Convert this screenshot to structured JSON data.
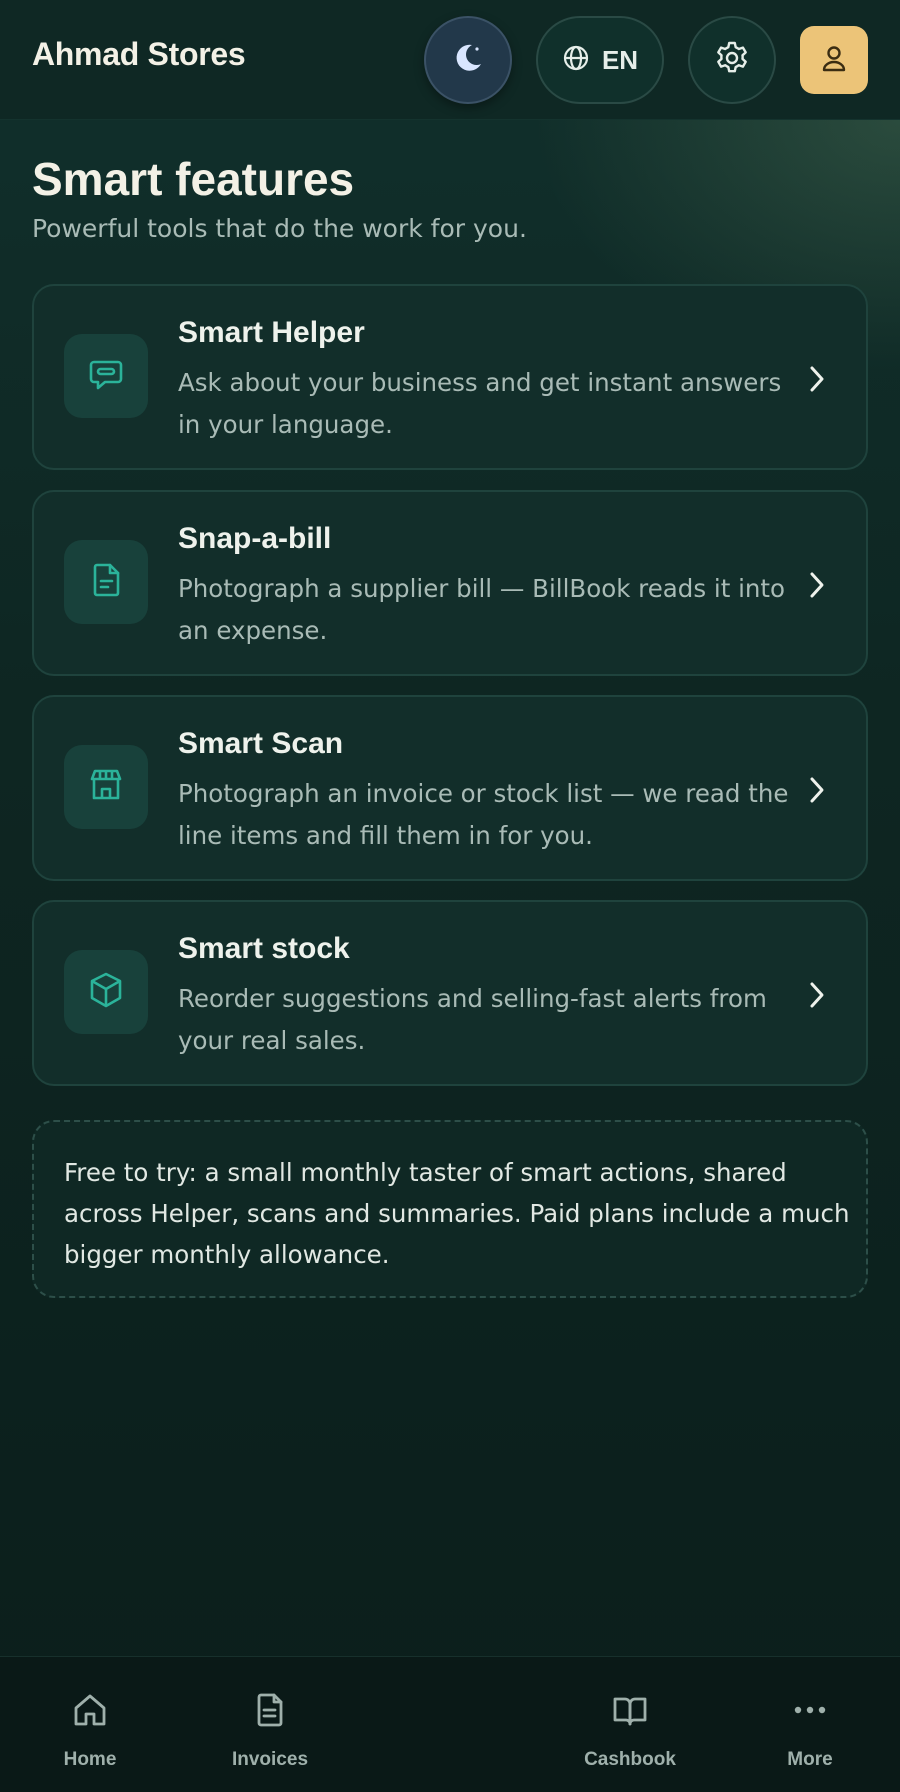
{
  "header": {
    "app_title": "Ahmad Stores",
    "language_label": "EN",
    "icons": {
      "theme": "moon-icon",
      "language": "globe-icon",
      "settings": "gear-icon",
      "profile": "user-icon"
    }
  },
  "hero": {
    "title": "Smart features",
    "subtitle": "Powerful tools that do the work for you."
  },
  "features": [
    {
      "title": "Smart Helper",
      "description": "Ask about your business and get instant answers in your language.",
      "icon": "chat-icon"
    },
    {
      "title": "Snap-a-bill",
      "description": "Photograph a supplier bill — BillBook reads it into an expense.",
      "icon": "document-icon"
    },
    {
      "title": "Smart Scan",
      "description": "Photograph an invoice or stock list — we read the line items and fill them in for you.",
      "icon": "store-icon"
    },
    {
      "title": "Smart stock",
      "description": "Reorder suggestions and selling-fast alerts from your real sales.",
      "icon": "box-icon"
    }
  ],
  "note": {
    "text": "Free to try: a small monthly taster of smart actions, shared across Helper, scans and summaries. Paid plans include a much bigger monthly allowance."
  },
  "bottom_nav": [
    {
      "label": "Home",
      "icon": "home-icon"
    },
    {
      "label": "Invoices",
      "icon": "document-icon"
    },
    {
      "label": "Cashbook",
      "icon": "book-icon"
    },
    {
      "label": "More",
      "icon": "more-icon"
    }
  ],
  "colors": {
    "accent": "#2bb39a",
    "background": "#0e2622",
    "card": "#122e2a",
    "profile": "#ecc478",
    "text_primary": "#f3f1e6",
    "text_secondary": "#a9bbb6"
  }
}
